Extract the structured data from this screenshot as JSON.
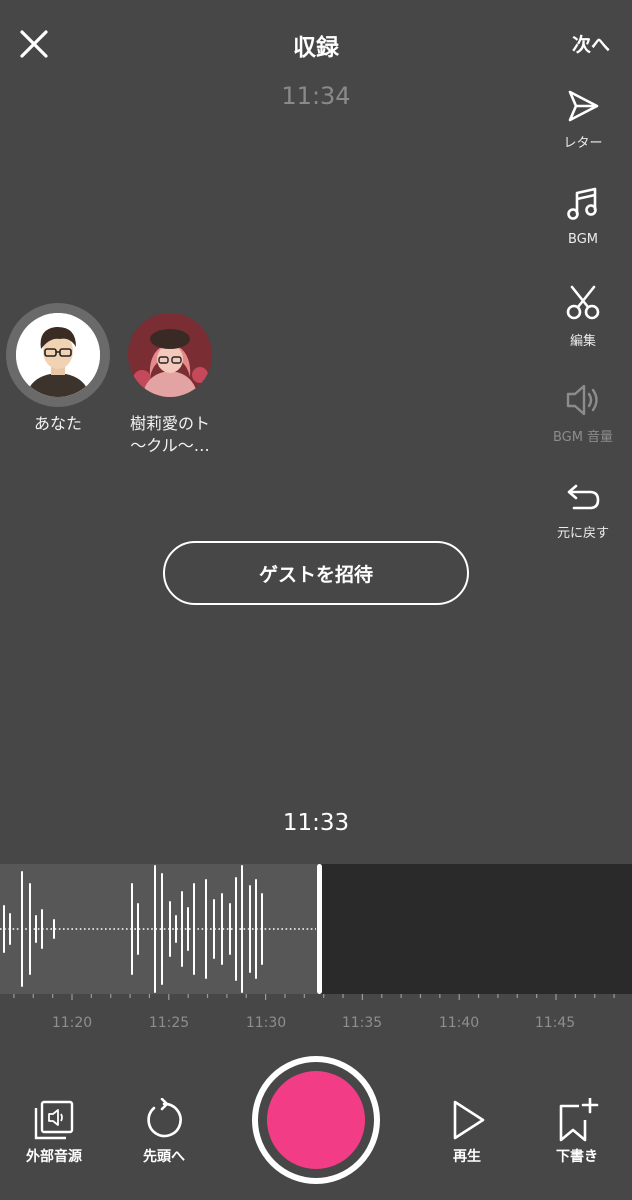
{
  "header": {
    "title": "収録",
    "next_label": "次へ",
    "elapsed": "11:34"
  },
  "tools": [
    {
      "label": "レター",
      "icon": "send-icon",
      "enabled": true
    },
    {
      "label": "BGM",
      "icon": "music-note-icon",
      "enabled": true
    },
    {
      "label": "編集",
      "icon": "scissors-icon",
      "enabled": true
    },
    {
      "label": "BGM 音量",
      "icon": "speaker-icon",
      "enabled": false
    },
    {
      "label": "元に戻す",
      "icon": "undo-icon",
      "enabled": true
    }
  ],
  "participants": [
    {
      "name": "あなた",
      "speaking": true
    },
    {
      "name_line1": "樹莉愛のト",
      "name_line2": "〜クル〜…",
      "speaking": false
    }
  ],
  "invite": {
    "label": "ゲストを招待"
  },
  "timeline": {
    "current_time": "11:33",
    "ticks": [
      "11:20",
      "11:25",
      "11:30",
      "11:35",
      "11:40",
      "11:45"
    ]
  },
  "bottom": {
    "external_audio": "外部音源",
    "to_start": "先頭へ",
    "play": "再生",
    "draft": "下書き"
  },
  "colors": {
    "background": "#474747",
    "record": "#f23d86",
    "waveform_bg": "#2a2a2a",
    "recorded_bg": "#575757"
  }
}
